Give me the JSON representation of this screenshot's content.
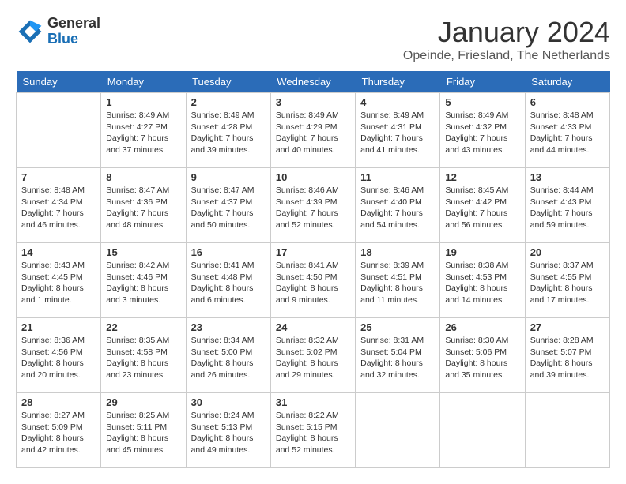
{
  "header": {
    "logo_general": "General",
    "logo_blue": "Blue",
    "month_title": "January 2024",
    "location": "Opeinde, Friesland, The Netherlands"
  },
  "weekdays": [
    "Sunday",
    "Monday",
    "Tuesday",
    "Wednesday",
    "Thursday",
    "Friday",
    "Saturday"
  ],
  "weeks": [
    [
      {
        "day": "",
        "sunrise": "",
        "sunset": "",
        "daylight": ""
      },
      {
        "day": "1",
        "sunrise": "Sunrise: 8:49 AM",
        "sunset": "Sunset: 4:27 PM",
        "daylight": "Daylight: 7 hours and 37 minutes."
      },
      {
        "day": "2",
        "sunrise": "Sunrise: 8:49 AM",
        "sunset": "Sunset: 4:28 PM",
        "daylight": "Daylight: 7 hours and 39 minutes."
      },
      {
        "day": "3",
        "sunrise": "Sunrise: 8:49 AM",
        "sunset": "Sunset: 4:29 PM",
        "daylight": "Daylight: 7 hours and 40 minutes."
      },
      {
        "day": "4",
        "sunrise": "Sunrise: 8:49 AM",
        "sunset": "Sunset: 4:31 PM",
        "daylight": "Daylight: 7 hours and 41 minutes."
      },
      {
        "day": "5",
        "sunrise": "Sunrise: 8:49 AM",
        "sunset": "Sunset: 4:32 PM",
        "daylight": "Daylight: 7 hours and 43 minutes."
      },
      {
        "day": "6",
        "sunrise": "Sunrise: 8:48 AM",
        "sunset": "Sunset: 4:33 PM",
        "daylight": "Daylight: 7 hours and 44 minutes."
      }
    ],
    [
      {
        "day": "7",
        "sunrise": "Sunrise: 8:48 AM",
        "sunset": "Sunset: 4:34 PM",
        "daylight": "Daylight: 7 hours and 46 minutes."
      },
      {
        "day": "8",
        "sunrise": "Sunrise: 8:47 AM",
        "sunset": "Sunset: 4:36 PM",
        "daylight": "Daylight: 7 hours and 48 minutes."
      },
      {
        "day": "9",
        "sunrise": "Sunrise: 8:47 AM",
        "sunset": "Sunset: 4:37 PM",
        "daylight": "Daylight: 7 hours and 50 minutes."
      },
      {
        "day": "10",
        "sunrise": "Sunrise: 8:46 AM",
        "sunset": "Sunset: 4:39 PM",
        "daylight": "Daylight: 7 hours and 52 minutes."
      },
      {
        "day": "11",
        "sunrise": "Sunrise: 8:46 AM",
        "sunset": "Sunset: 4:40 PM",
        "daylight": "Daylight: 7 hours and 54 minutes."
      },
      {
        "day": "12",
        "sunrise": "Sunrise: 8:45 AM",
        "sunset": "Sunset: 4:42 PM",
        "daylight": "Daylight: 7 hours and 56 minutes."
      },
      {
        "day": "13",
        "sunrise": "Sunrise: 8:44 AM",
        "sunset": "Sunset: 4:43 PM",
        "daylight": "Daylight: 7 hours and 59 minutes."
      }
    ],
    [
      {
        "day": "14",
        "sunrise": "Sunrise: 8:43 AM",
        "sunset": "Sunset: 4:45 PM",
        "daylight": "Daylight: 8 hours and 1 minute."
      },
      {
        "day": "15",
        "sunrise": "Sunrise: 8:42 AM",
        "sunset": "Sunset: 4:46 PM",
        "daylight": "Daylight: 8 hours and 3 minutes."
      },
      {
        "day": "16",
        "sunrise": "Sunrise: 8:41 AM",
        "sunset": "Sunset: 4:48 PM",
        "daylight": "Daylight: 8 hours and 6 minutes."
      },
      {
        "day": "17",
        "sunrise": "Sunrise: 8:41 AM",
        "sunset": "Sunset: 4:50 PM",
        "daylight": "Daylight: 8 hours and 9 minutes."
      },
      {
        "day": "18",
        "sunrise": "Sunrise: 8:39 AM",
        "sunset": "Sunset: 4:51 PM",
        "daylight": "Daylight: 8 hours and 11 minutes."
      },
      {
        "day": "19",
        "sunrise": "Sunrise: 8:38 AM",
        "sunset": "Sunset: 4:53 PM",
        "daylight": "Daylight: 8 hours and 14 minutes."
      },
      {
        "day": "20",
        "sunrise": "Sunrise: 8:37 AM",
        "sunset": "Sunset: 4:55 PM",
        "daylight": "Daylight: 8 hours and 17 minutes."
      }
    ],
    [
      {
        "day": "21",
        "sunrise": "Sunrise: 8:36 AM",
        "sunset": "Sunset: 4:56 PM",
        "daylight": "Daylight: 8 hours and 20 minutes."
      },
      {
        "day": "22",
        "sunrise": "Sunrise: 8:35 AM",
        "sunset": "Sunset: 4:58 PM",
        "daylight": "Daylight: 8 hours and 23 minutes."
      },
      {
        "day": "23",
        "sunrise": "Sunrise: 8:34 AM",
        "sunset": "Sunset: 5:00 PM",
        "daylight": "Daylight: 8 hours and 26 minutes."
      },
      {
        "day": "24",
        "sunrise": "Sunrise: 8:32 AM",
        "sunset": "Sunset: 5:02 PM",
        "daylight": "Daylight: 8 hours and 29 minutes."
      },
      {
        "day": "25",
        "sunrise": "Sunrise: 8:31 AM",
        "sunset": "Sunset: 5:04 PM",
        "daylight": "Daylight: 8 hours and 32 minutes."
      },
      {
        "day": "26",
        "sunrise": "Sunrise: 8:30 AM",
        "sunset": "Sunset: 5:06 PM",
        "daylight": "Daylight: 8 hours and 35 minutes."
      },
      {
        "day": "27",
        "sunrise": "Sunrise: 8:28 AM",
        "sunset": "Sunset: 5:07 PM",
        "daylight": "Daylight: 8 hours and 39 minutes."
      }
    ],
    [
      {
        "day": "28",
        "sunrise": "Sunrise: 8:27 AM",
        "sunset": "Sunset: 5:09 PM",
        "daylight": "Daylight: 8 hours and 42 minutes."
      },
      {
        "day": "29",
        "sunrise": "Sunrise: 8:25 AM",
        "sunset": "Sunset: 5:11 PM",
        "daylight": "Daylight: 8 hours and 45 minutes."
      },
      {
        "day": "30",
        "sunrise": "Sunrise: 8:24 AM",
        "sunset": "Sunset: 5:13 PM",
        "daylight": "Daylight: 8 hours and 49 minutes."
      },
      {
        "day": "31",
        "sunrise": "Sunrise: 8:22 AM",
        "sunset": "Sunset: 5:15 PM",
        "daylight": "Daylight: 8 hours and 52 minutes."
      },
      {
        "day": "",
        "sunrise": "",
        "sunset": "",
        "daylight": ""
      },
      {
        "day": "",
        "sunrise": "",
        "sunset": "",
        "daylight": ""
      },
      {
        "day": "",
        "sunrise": "",
        "sunset": "",
        "daylight": ""
      }
    ]
  ]
}
